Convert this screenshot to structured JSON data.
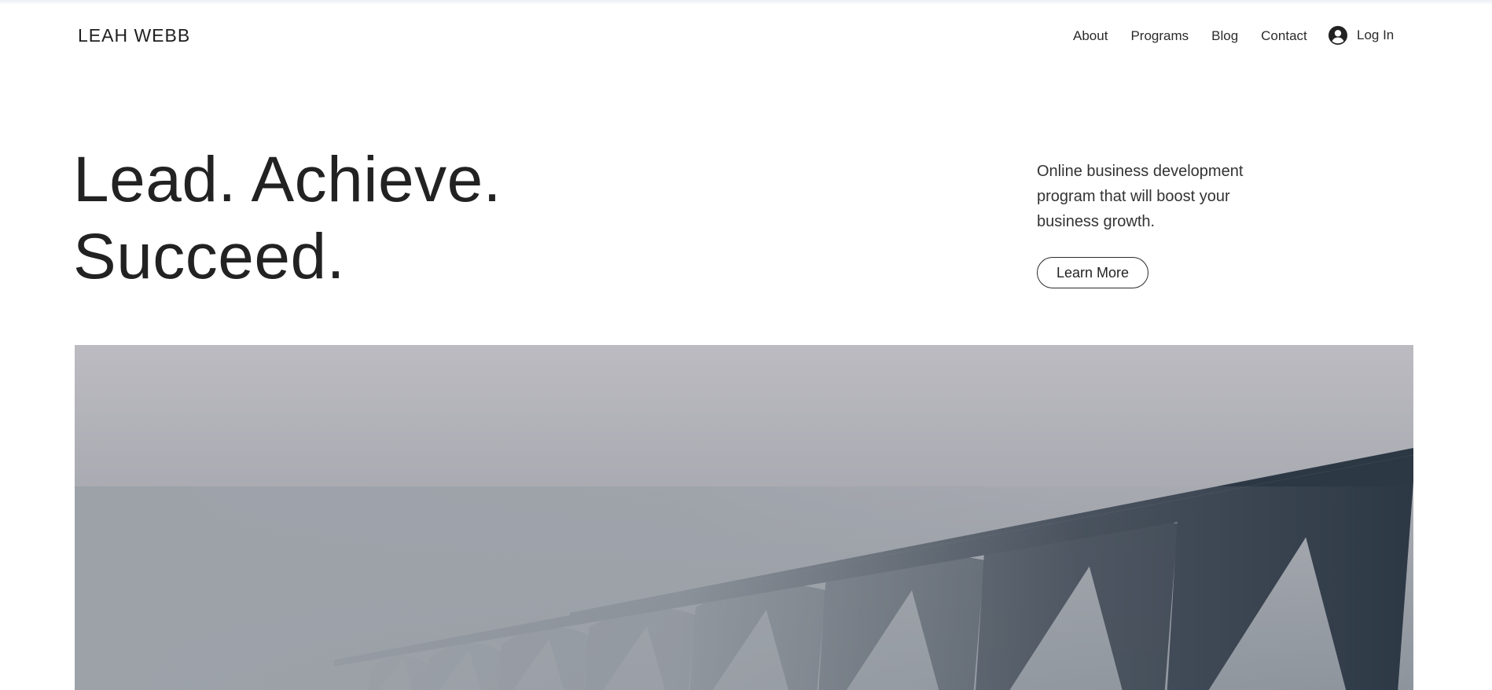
{
  "header": {
    "logo": "LEAH WEBB",
    "nav": [
      "About",
      "Programs",
      "Blog",
      "Contact"
    ],
    "login_label": "Log In"
  },
  "hero": {
    "title_line1": "Lead. Achieve.",
    "title_line2": "Succeed.",
    "description": "Online business development program that will boost your business growth.",
    "cta_label": "Learn More"
  },
  "image": {
    "subject": "foggy-bridge-photo",
    "colors": {
      "sky_top": "#bcbbc1",
      "sky_bottom": "#8d949c",
      "bridge": "#2d3845"
    }
  },
  "colors": {
    "text": "#262626",
    "background": "#ffffff"
  }
}
